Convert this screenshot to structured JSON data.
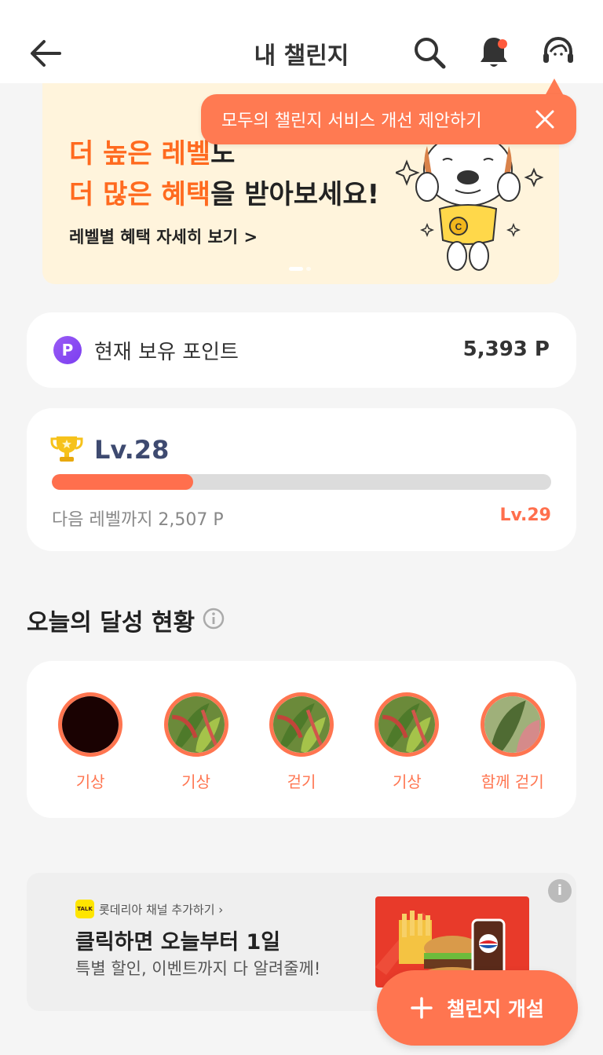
{
  "header": {
    "title": "내 챌린지",
    "back_icon": "arrow-left-icon",
    "search_icon": "search-icon",
    "notification_icon": "bell-icon",
    "support_icon": "headset-icon"
  },
  "tooltip": {
    "text": "모두의 챌린지 서비스 개선 제안하기",
    "close_icon": "close-icon"
  },
  "banner": {
    "line1_highlight": "더 높은 레벨",
    "line1_rest": "도",
    "line2_highlight": "더 많은 혜택",
    "line2_rest": "을 받아보세요!",
    "link": "레벨별 혜택 자세히 보기 >"
  },
  "points": {
    "icon_letter": "P",
    "label": "현재 보유 포인트",
    "value": "5,393 P"
  },
  "level": {
    "current": "Lv.28",
    "progress": 0.283,
    "next_label": "다음 레벨까지 2,507 P",
    "next_level": "Lv.29"
  },
  "achievements": {
    "title": "오늘의 달성 현황",
    "items": [
      {
        "label": "기상",
        "thumb": "dark"
      },
      {
        "label": "기상",
        "thumb": "plant"
      },
      {
        "label": "걷기",
        "thumb": "plant"
      },
      {
        "label": "기상",
        "thumb": "plant"
      },
      {
        "label": "함께 걷기",
        "thumb": "leaf"
      }
    ]
  },
  "ad": {
    "talk_badge": "TALK",
    "channel": "롯데리아 채널 추가하기 ›",
    "title": "클릭하면 오늘부터 1일",
    "subtitle": "특별 할인, 이벤트까지 다 알려줄께!",
    "info": "i"
  },
  "fab": {
    "label": "챌린지 개설"
  },
  "colors": {
    "accent": "#ff7550",
    "banner_bg": "#fff4dc",
    "level_text": "#3e4a70",
    "background": "#f5f5f5"
  }
}
